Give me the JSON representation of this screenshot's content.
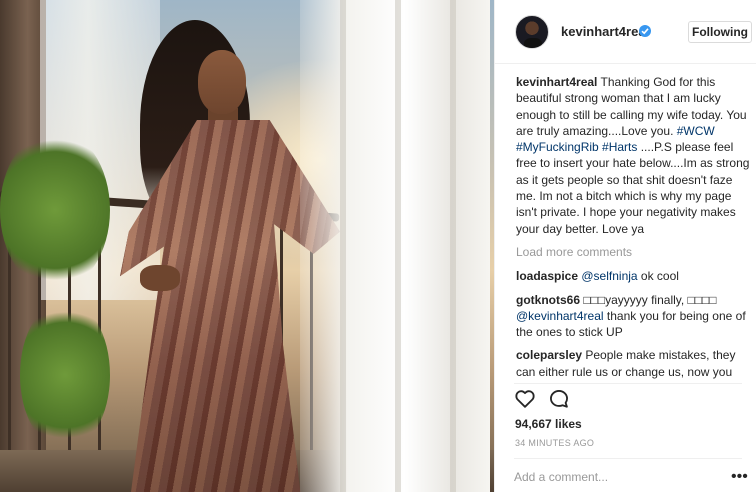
{
  "post": {
    "image_alt": "Photo of a pregnant woman in a flowing patterned dress standing on a balcony between white curtains",
    "author": {
      "username": "kevinhart4real",
      "verified": true
    },
    "follow_button": "Following",
    "caption": {
      "username": "kevinhart4real",
      "text_1": "Thanking God for this beautiful strong woman that I am lucky enough to still be calling my wife today. You are truly amazing....Love you. ",
      "hashtag_1": "#WCW",
      "hashtag_2": "#MyFuckingRib",
      "hashtag_3": "#Harts",
      "text_2": " ....P.S please feel free to insert your hate below....Im as strong as it gets people so that shit doesn't faze me. Im not a bitch which is why my page isn't private. I hope your negativity makes your day better. Love ya"
    },
    "load_more": "Load more comments",
    "comments": [
      {
        "username": "loadaspice",
        "mention": "@selfninja",
        "text": " ok cool"
      },
      {
        "username": "gotknots66",
        "text_pre": " □□□yayyyyy finally, □□□□ ",
        "mention": "@kevinhart4real",
        "text": " thank you for being one of the ones to stick UP"
      },
      {
        "username": "coleparsley",
        "text": " People make mistakes, they can either rule us or change us, now you realize the wonderful thing you have and how much its worth"
      }
    ],
    "likes": "94,667 likes",
    "timestamp": "34 MINUTES AGO",
    "add_comment_placeholder": "Add a comment...",
    "more_label": "•••"
  },
  "icons": {
    "verified": "verified-badge-icon",
    "like": "heart-icon",
    "comment": "comment-bubble-icon",
    "more": "more-options-icon"
  },
  "colors": {
    "link": "#003569",
    "muted": "#999999",
    "verified": "#3897f0",
    "text": "#262626"
  }
}
